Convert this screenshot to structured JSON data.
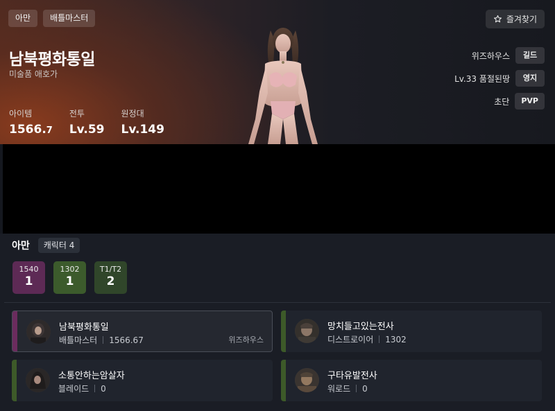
{
  "header": {
    "server_tag": "아만",
    "class_tag": "배틀마스터",
    "favorite_label": "즐겨찾기",
    "character_name": "남북평화통일",
    "character_title": "미술품 애호가",
    "stats": [
      {
        "label": "아이템",
        "value_main": "1566.",
        "value_small": "7"
      },
      {
        "label": "전투",
        "value_main": "Lv.59",
        "value_small": ""
      },
      {
        "label": "원정대",
        "value_main": "Lv.149",
        "value_small": ""
      }
    ],
    "info": [
      {
        "text": "위즈하우스",
        "chip": "길드"
      },
      {
        "text": "Lv.33 품절된땅",
        "chip": "영지"
      },
      {
        "text": "초단",
        "chip": "PVP"
      }
    ]
  },
  "roster": {
    "server": "아만",
    "count_label": "캐릭터 4",
    "tiers": [
      {
        "label": "1540",
        "count": "1",
        "color": "#5d2a55"
      },
      {
        "label": "1302",
        "count": "1",
        "color": "#3c5b2c"
      },
      {
        "label": "T1/T2",
        "count": "2",
        "color": "#30462a"
      }
    ],
    "characters": [
      {
        "name": "남북평화통일",
        "class": "배틀마스터",
        "level": "1566.67",
        "guild": "위즈하우스",
        "accent": "#6b2c5e"
      },
      {
        "name": "망치들고있는전사",
        "class": "디스트로이어",
        "level": "1302",
        "guild": "",
        "accent": "#3d5a29"
      },
      {
        "name": "소통안하는암살자",
        "class": "블레이드",
        "level": "0",
        "guild": "",
        "accent": "#3d5a29"
      },
      {
        "name": "구타유발전사",
        "class": "워로드",
        "level": "0",
        "guild": "",
        "accent": "#3d5a29"
      }
    ]
  }
}
